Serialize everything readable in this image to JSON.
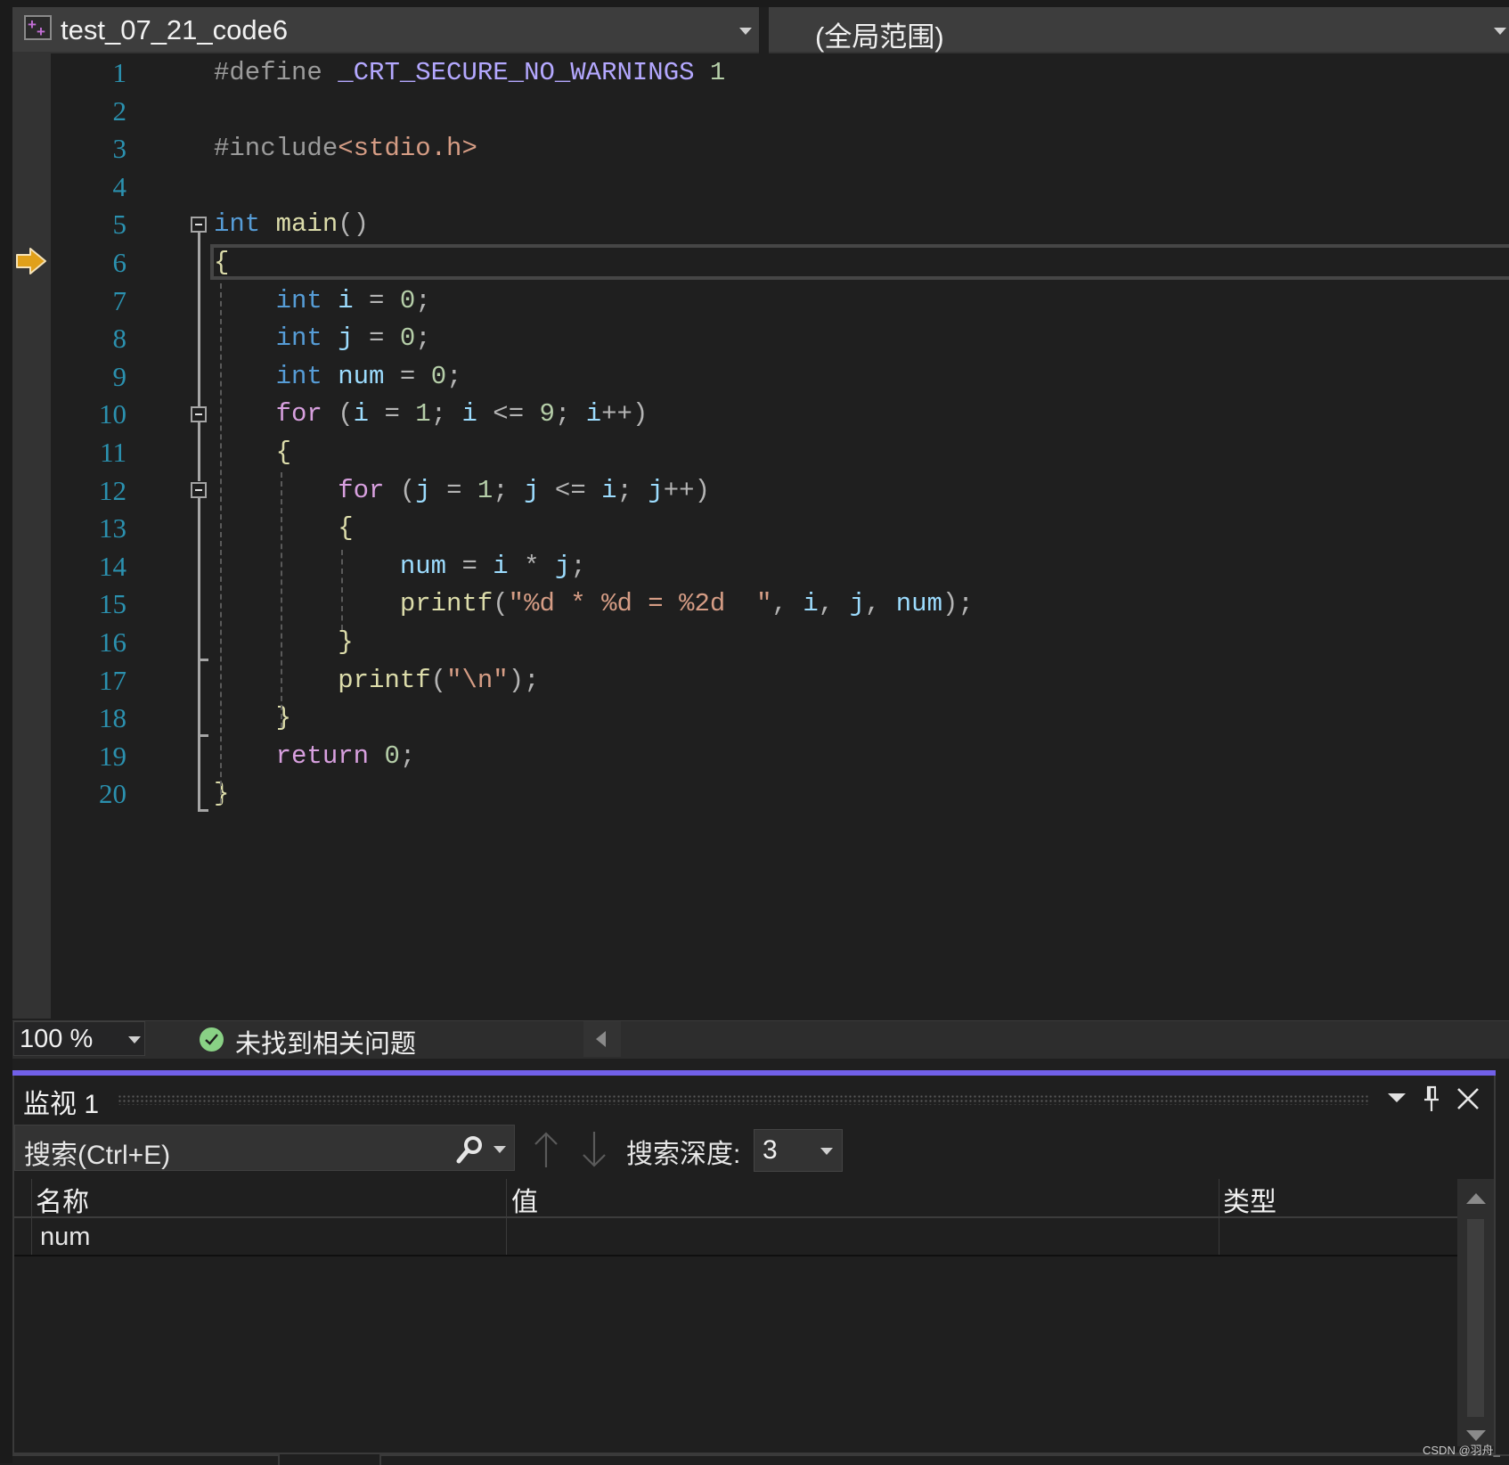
{
  "navbar": {
    "file_dropdown": "test_07_21_code6",
    "scope_dropdown": "(全局范围)"
  },
  "editor": {
    "current_line": 6,
    "line_numbers": [
      "1",
      "2",
      "3",
      "4",
      "5",
      "6",
      "7",
      "8",
      "9",
      "10",
      "11",
      "12",
      "13",
      "14",
      "15",
      "16",
      "17",
      "18",
      "19",
      "20"
    ],
    "lines": [
      [
        {
          "t": "#define ",
          "c": "pp"
        },
        {
          "t": "_CRT_SECURE_NO_WARNINGS",
          "c": "mac"
        },
        {
          "t": " 1",
          "c": "num"
        }
      ],
      [],
      [
        {
          "t": "#include",
          "c": "pp"
        },
        {
          "t": "<stdio.h>",
          "c": "str"
        }
      ],
      [],
      [
        {
          "t": "int",
          "c": "kw"
        },
        {
          "t": " ",
          "c": ""
        },
        {
          "t": "main",
          "c": "fn"
        },
        {
          "t": "()",
          "c": "punc"
        }
      ],
      [
        {
          "t": "{",
          "c": "brace"
        }
      ],
      [
        {
          "t": "    ",
          "c": ""
        },
        {
          "t": "int",
          "c": "kw"
        },
        {
          "t": " ",
          "c": ""
        },
        {
          "t": "i",
          "c": "var"
        },
        {
          "t": " = ",
          "c": "punc"
        },
        {
          "t": "0",
          "c": "num"
        },
        {
          "t": ";",
          "c": "punc"
        }
      ],
      [
        {
          "t": "    ",
          "c": ""
        },
        {
          "t": "int",
          "c": "kw"
        },
        {
          "t": " ",
          "c": ""
        },
        {
          "t": "j",
          "c": "var"
        },
        {
          "t": " = ",
          "c": "punc"
        },
        {
          "t": "0",
          "c": "num"
        },
        {
          "t": ";",
          "c": "punc"
        }
      ],
      [
        {
          "t": "    ",
          "c": ""
        },
        {
          "t": "int",
          "c": "kw"
        },
        {
          "t": " ",
          "c": ""
        },
        {
          "t": "num",
          "c": "var"
        },
        {
          "t": " = ",
          "c": "punc"
        },
        {
          "t": "0",
          "c": "num"
        },
        {
          "t": ";",
          "c": "punc"
        }
      ],
      [
        {
          "t": "    ",
          "c": ""
        },
        {
          "t": "for",
          "c": "ctl"
        },
        {
          "t": " (",
          "c": "punc"
        },
        {
          "t": "i",
          "c": "var"
        },
        {
          "t": " = ",
          "c": "punc"
        },
        {
          "t": "1",
          "c": "num"
        },
        {
          "t": "; ",
          "c": "punc"
        },
        {
          "t": "i",
          "c": "var"
        },
        {
          "t": " <= ",
          "c": "punc"
        },
        {
          "t": "9",
          "c": "num"
        },
        {
          "t": "; ",
          "c": "punc"
        },
        {
          "t": "i",
          "c": "var"
        },
        {
          "t": "++)",
          "c": "punc"
        }
      ],
      [
        {
          "t": "    ",
          "c": ""
        },
        {
          "t": "{",
          "c": "brace"
        }
      ],
      [
        {
          "t": "        ",
          "c": ""
        },
        {
          "t": "for",
          "c": "ctl"
        },
        {
          "t": " (",
          "c": "punc"
        },
        {
          "t": "j",
          "c": "var"
        },
        {
          "t": " = ",
          "c": "punc"
        },
        {
          "t": "1",
          "c": "num"
        },
        {
          "t": "; ",
          "c": "punc"
        },
        {
          "t": "j",
          "c": "var"
        },
        {
          "t": " <= ",
          "c": "punc"
        },
        {
          "t": "i",
          "c": "var"
        },
        {
          "t": "; ",
          "c": "punc"
        },
        {
          "t": "j",
          "c": "var"
        },
        {
          "t": "++)",
          "c": "punc"
        }
      ],
      [
        {
          "t": "        ",
          "c": ""
        },
        {
          "t": "{",
          "c": "brace"
        }
      ],
      [
        {
          "t": "            ",
          "c": ""
        },
        {
          "t": "num",
          "c": "var"
        },
        {
          "t": " = ",
          "c": "punc"
        },
        {
          "t": "i",
          "c": "var"
        },
        {
          "t": " * ",
          "c": "punc"
        },
        {
          "t": "j",
          "c": "var"
        },
        {
          "t": ";",
          "c": "punc"
        }
      ],
      [
        {
          "t": "            ",
          "c": ""
        },
        {
          "t": "printf",
          "c": "fn"
        },
        {
          "t": "(",
          "c": "punc"
        },
        {
          "t": "\"%d * %d = %2d  \"",
          "c": "str"
        },
        {
          "t": ", ",
          "c": "punc"
        },
        {
          "t": "i",
          "c": "var"
        },
        {
          "t": ", ",
          "c": "punc"
        },
        {
          "t": "j",
          "c": "var"
        },
        {
          "t": ", ",
          "c": "punc"
        },
        {
          "t": "num",
          "c": "var"
        },
        {
          "t": ");",
          "c": "punc"
        }
      ],
      [
        {
          "t": "        ",
          "c": ""
        },
        {
          "t": "}",
          "c": "brace"
        }
      ],
      [
        {
          "t": "        ",
          "c": ""
        },
        {
          "t": "printf",
          "c": "fn"
        },
        {
          "t": "(",
          "c": "punc"
        },
        {
          "t": "\"\\n\"",
          "c": "str"
        },
        {
          "t": ");",
          "c": "punc"
        }
      ],
      [
        {
          "t": "    ",
          "c": ""
        },
        {
          "t": "}",
          "c": "brace"
        }
      ],
      [
        {
          "t": "    ",
          "c": ""
        },
        {
          "t": "return",
          "c": "ctl"
        },
        {
          "t": " ",
          "c": ""
        },
        {
          "t": "0",
          "c": "num"
        },
        {
          "t": ";",
          "c": "punc"
        }
      ],
      [
        {
          "t": "}",
          "c": "brace"
        }
      ]
    ]
  },
  "statusbar": {
    "zoom_level": "100 %",
    "issues_text": "未找到相关问题"
  },
  "watch": {
    "title": "监视 1",
    "search_placeholder": "搜索(Ctrl+E)",
    "search_depth_label": "搜索深度:",
    "search_depth_value": "3",
    "columns": [
      "名称",
      "值",
      "类型"
    ],
    "rows": [
      {
        "name": "num",
        "value": "",
        "type": ""
      }
    ]
  },
  "watermark": "CSDN @羽舟_",
  "colors": {
    "accent": "#7160e8",
    "keyword": "#569cd6",
    "control": "#d8a0df",
    "variable": "#9cdcfe",
    "function": "#dcdcaa",
    "number": "#b5cea8",
    "string": "#d69d85",
    "line_number": "#2b91af",
    "exec_arrow": "#e0a01a"
  }
}
